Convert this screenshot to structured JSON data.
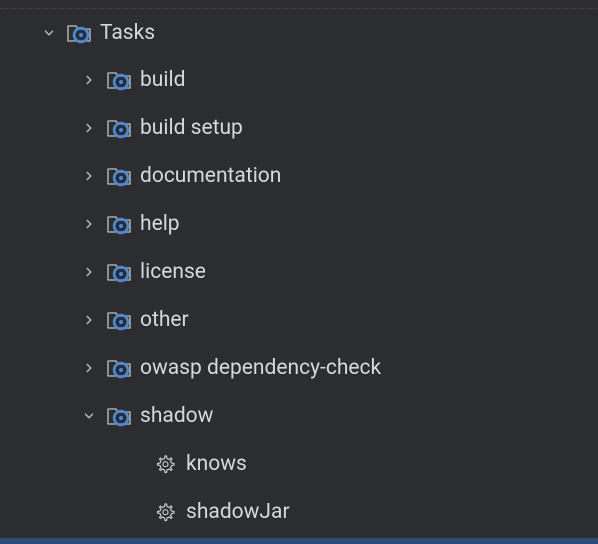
{
  "tree": {
    "root": {
      "label": "Tasks",
      "expanded": true
    },
    "groups": [
      {
        "label": "build",
        "expanded": false
      },
      {
        "label": "build setup",
        "expanded": false
      },
      {
        "label": "documentation",
        "expanded": false
      },
      {
        "label": "help",
        "expanded": false
      },
      {
        "label": "license",
        "expanded": false
      },
      {
        "label": "other",
        "expanded": false
      },
      {
        "label": "owasp dependency-check",
        "expanded": false
      },
      {
        "label": "shadow",
        "expanded": true
      }
    ],
    "shadow_tasks": [
      {
        "label": "knows"
      },
      {
        "label": "shadowJar"
      }
    ]
  }
}
